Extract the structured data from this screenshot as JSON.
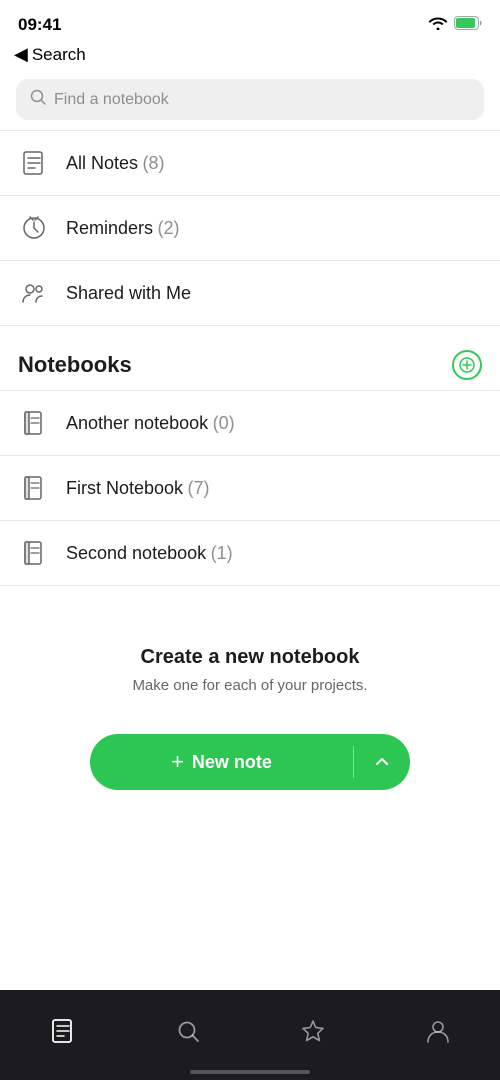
{
  "statusBar": {
    "time": "09:41",
    "wifiAlt": "wifi",
    "batteryAlt": "battery"
  },
  "backNav": {
    "arrow": "◀",
    "label": "Search"
  },
  "searchBar": {
    "placeholder": "Find a notebook"
  },
  "listItems": [
    {
      "id": "all-notes",
      "icon": "notes",
      "label": "All Notes",
      "count": "(8)"
    },
    {
      "id": "reminders",
      "icon": "reminder",
      "label": "Reminders",
      "count": "(2)"
    },
    {
      "id": "shared",
      "icon": "shared",
      "label": "Shared with Me",
      "count": ""
    }
  ],
  "notebooks": {
    "sectionTitle": "Notebooks",
    "addButtonLabel": "+",
    "items": [
      {
        "id": "another",
        "label": "Another notebook",
        "count": "(0)"
      },
      {
        "id": "first",
        "label": "First Notebook",
        "count": "(7)"
      },
      {
        "id": "second",
        "label": "Second notebook",
        "count": "(1)"
      }
    ]
  },
  "promo": {
    "title": "Create a new notebook",
    "subtitle": "Make one for each of your projects."
  },
  "newNote": {
    "plusIcon": "+",
    "label": "New note",
    "chevron": "∧"
  },
  "tabBar": {
    "items": [
      {
        "id": "notes",
        "icon": "notes",
        "active": true
      },
      {
        "id": "search",
        "icon": "search",
        "active": false
      },
      {
        "id": "shortcuts",
        "icon": "star",
        "active": false
      },
      {
        "id": "account",
        "icon": "person",
        "active": false
      }
    ]
  }
}
